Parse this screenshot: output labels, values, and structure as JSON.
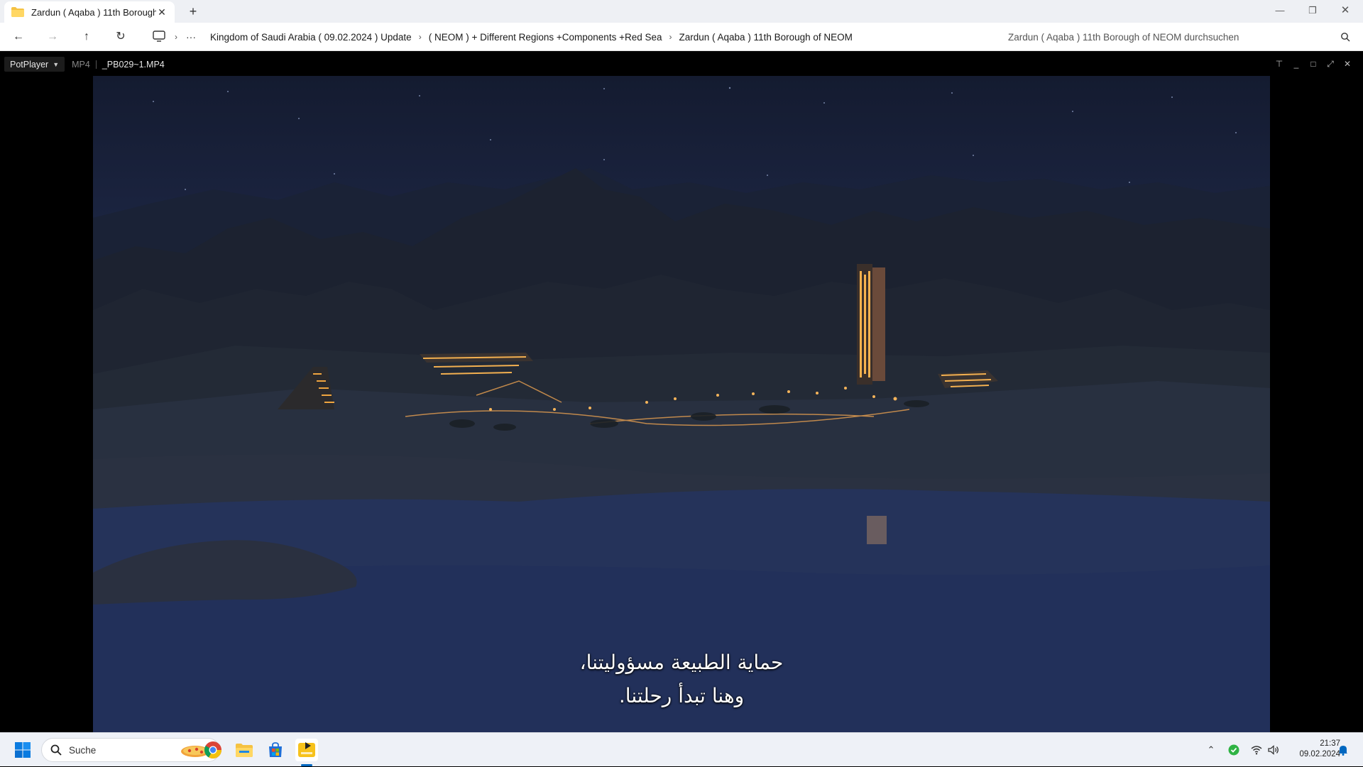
{
  "explorer": {
    "tab_title": "Zardun ( Aqaba )  11th Borough of NEOM",
    "breadcrumbs": [
      "Kingdom of Saudi Arabia ( 09.02.2024 ) Update",
      "( NEOM ) + Different Regions +Components +Red Sea",
      "Zardun ( Aqaba )  11th Borough of NEOM"
    ],
    "search_placeholder": "Zardun ( Aqaba )  11th Borough of NEOM durchsuchen"
  },
  "player": {
    "brand": "PotPlayer",
    "format": "MP4",
    "filename": "_PB029~1.MP4",
    "subtitles": [
      "حماية الطبيعة مسؤوليتنا،",
      "وهنا تبدأ رحلتنا."
    ]
  },
  "taskbar": {
    "search_label": "Suche",
    "time": "21:37",
    "date": "09.02.2024"
  },
  "icons": {
    "start": "windows-logo-icon",
    "chrome": "chrome-icon",
    "explorer": "file-explorer-icon",
    "store": "microsoft-store-icon",
    "potplayer": "potplayer-icon"
  },
  "colors": {
    "accent": "#0067c0",
    "video_sky": "#141b30",
    "city_lights": "#f0a540"
  }
}
